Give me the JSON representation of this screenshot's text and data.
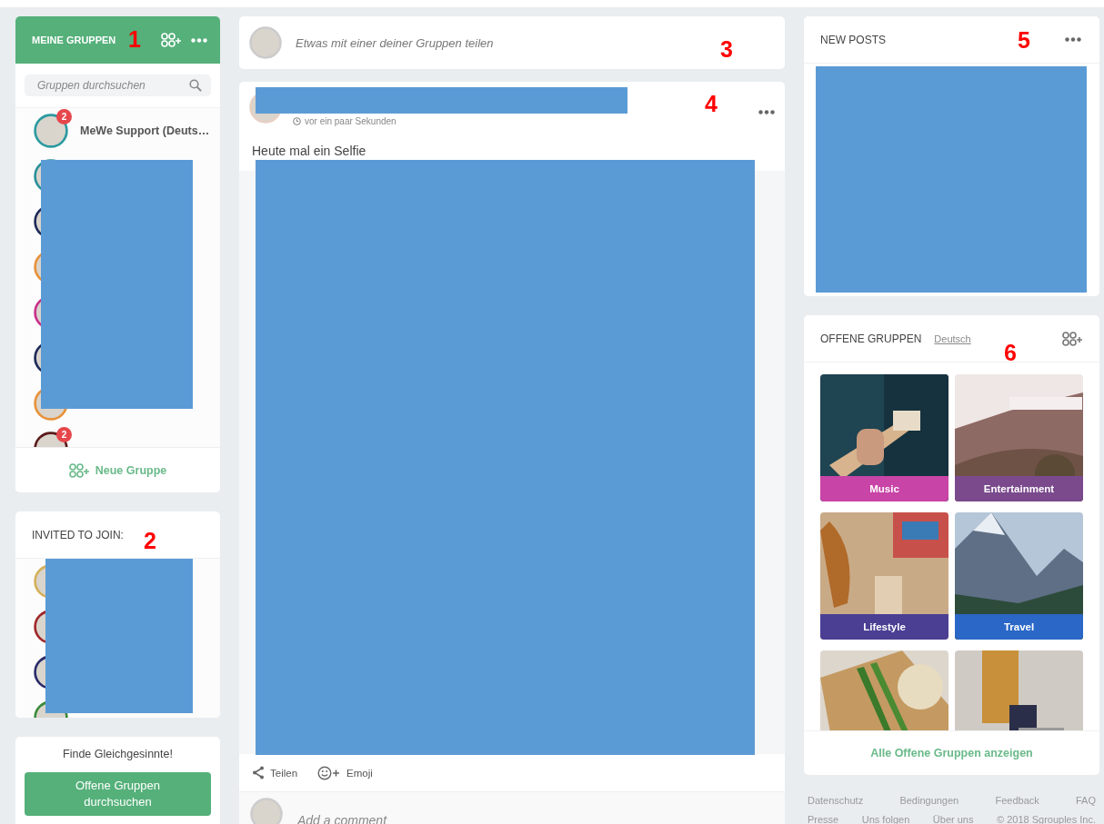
{
  "annotations": [
    "1",
    "2",
    "3",
    "4",
    "5",
    "6"
  ],
  "my_groups": {
    "title": "MEINE GRUPPEN",
    "search": {
      "placeholder": "Gruppen durchsuchen"
    },
    "items": [
      {
        "kind": "avatar",
        "name": "MeWe Support (Deuts…",
        "badge": "2"
      },
      {
        "kind": "avatar"
      },
      {
        "kind": "avatar"
      },
      {
        "kind": "avatar"
      },
      {
        "kind": "avatar"
      },
      {
        "kind": "avatar"
      },
      {
        "kind": "avatar"
      },
      {
        "kind": "avatar",
        "badge": "2"
      }
    ],
    "new_group": "Neue Gruppe"
  },
  "invited": {
    "title": "INVITED TO JOIN:",
    "items": [
      {
        "kind": "avatar"
      },
      {
        "kind": "avatar"
      },
      {
        "kind": "avatar"
      },
      {
        "kind": "avatar"
      }
    ]
  },
  "find": {
    "text": "Finde Gleichgesinnte!",
    "button": "Offene Gruppen durchsuchen"
  },
  "composer": {
    "placeholder": "Etwas mit einer deiner Gruppen teilen"
  },
  "post": {
    "time": "vor ein paar Sekunden",
    "text": "Heute mal ein Selfie",
    "actions": [
      {
        "kind": "share",
        "label": "Teilen"
      },
      {
        "kind": "emoji",
        "label": "Emoji"
      }
    ],
    "comment": {
      "placeholder": "Add a comment"
    }
  },
  "new_posts": {
    "title": "NEW POSTS"
  },
  "open_groups": {
    "title": "OFFENE GRUPPEN",
    "language": "Deutsch",
    "tiles": [
      {
        "kind": "labeled",
        "label": "Music",
        "color": "#c844a6"
      },
      {
        "kind": "labeled",
        "label": "Entertainment",
        "color": "#7a4a8c"
      },
      {
        "kind": "labeled",
        "label": "Lifestyle",
        "color": "#4a3f93"
      },
      {
        "kind": "labeled",
        "label": "Travel",
        "color": "#2a67c6"
      },
      {
        "kind": "picture"
      },
      {
        "kind": "picture"
      }
    ],
    "show_all": "Alle Offene Gruppen anzeigen"
  },
  "footer": {
    "links": [
      "Datenschutz",
      "Bedingungen",
      "Feedback",
      "FAQ"
    ],
    "more_links": [
      "Presse",
      "Uns folgen",
      "Über uns",
      "© 2018 Sgrouples Inc."
    ]
  }
}
